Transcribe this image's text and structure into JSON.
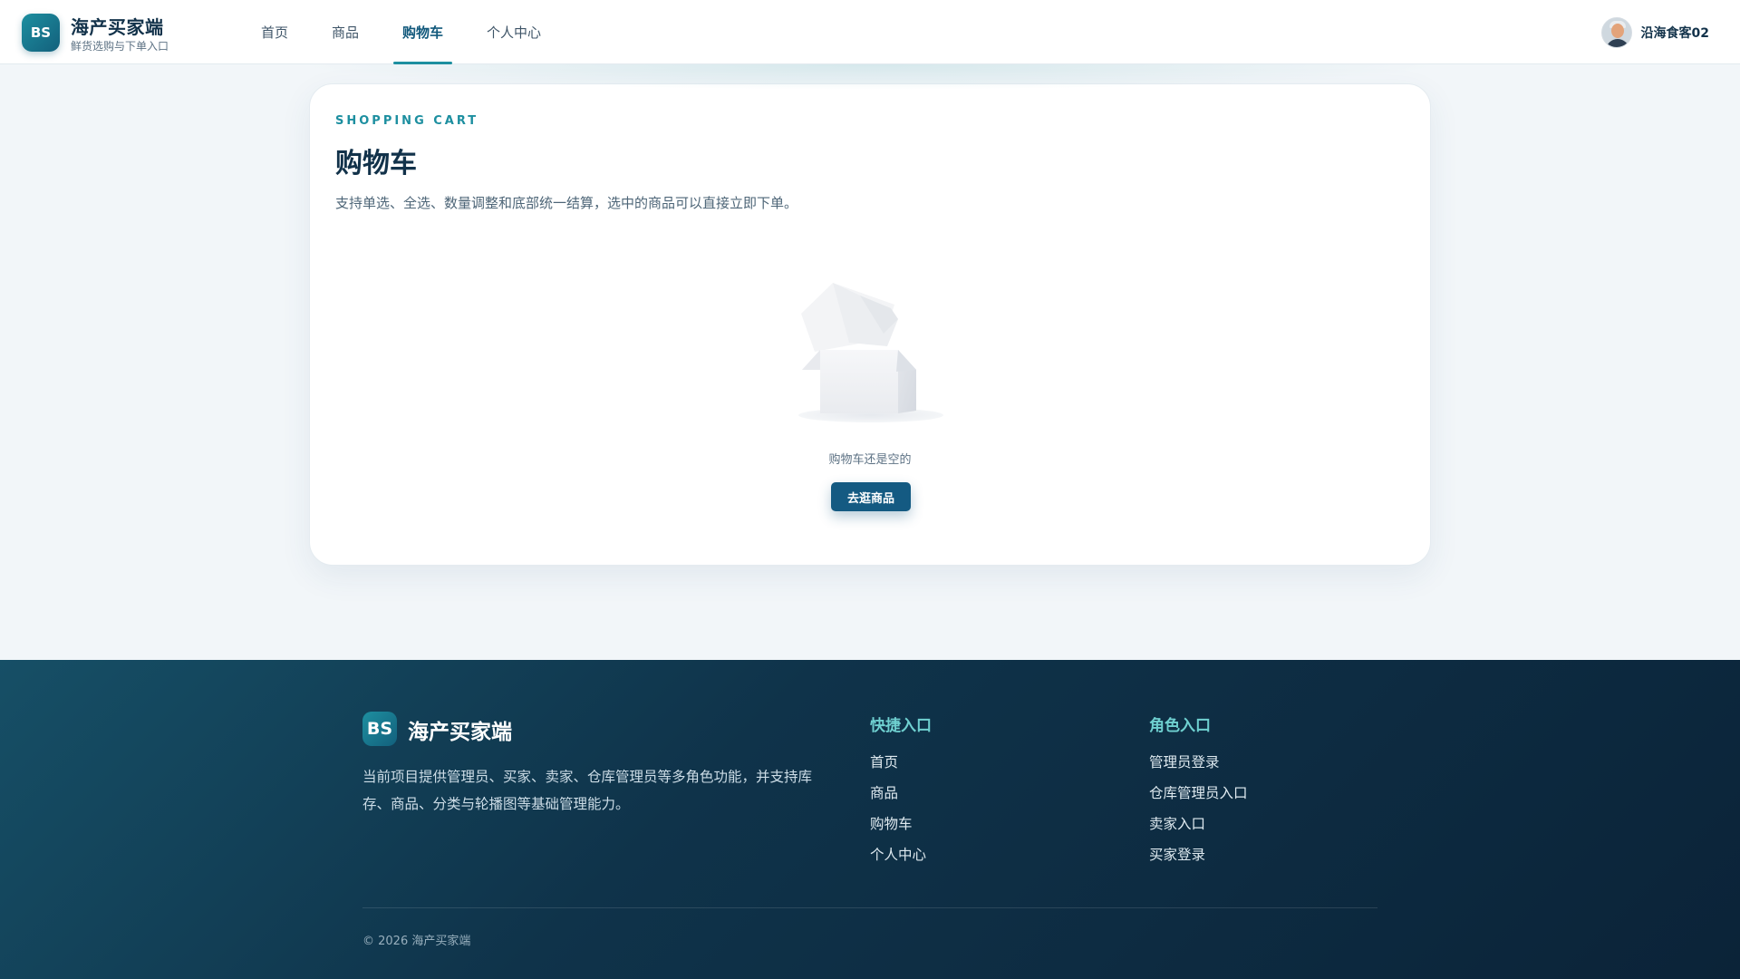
{
  "header": {
    "logo_text": "BS",
    "title": "海产买家端",
    "subtitle": "鲜货选购与下单入口",
    "nav": [
      {
        "label": "首页",
        "active": false
      },
      {
        "label": "商品",
        "active": false
      },
      {
        "label": "购物车",
        "active": true
      },
      {
        "label": "个人中心",
        "active": false
      }
    ],
    "user_name": "沿海食客02"
  },
  "cart": {
    "eyebrow": "SHOPPING CART",
    "title": "购物车",
    "description": "支持单选、全选、数量调整和底部统一结算，选中的商品可以直接立即下单。",
    "empty_text": "购物车还是空的",
    "shop_button": "去逛商品"
  },
  "footer": {
    "logo_text": "BS",
    "title": "海产买家端",
    "description": "当前项目提供管理员、买家、卖家、仓库管理员等多角色功能，并支持库存、商品、分类与轮播图等基础管理能力。",
    "quick_title": "快捷入口",
    "quick_links": [
      "首页",
      "商品",
      "购物车",
      "个人中心"
    ],
    "role_title": "角色入口",
    "role_links": [
      "管理员登录",
      "仓库管理员入口",
      "卖家入口",
      "买家登录"
    ],
    "copyright": "© 2026 海产买家端"
  },
  "colors": {
    "accent": "#1d8fa0",
    "primary_button": "#145a82",
    "footer_bg": "#0f334a",
    "footer_heading": "#6fd0d0"
  },
  "icons": {
    "empty_state": "empty-box-icon",
    "avatar": "user-avatar"
  }
}
